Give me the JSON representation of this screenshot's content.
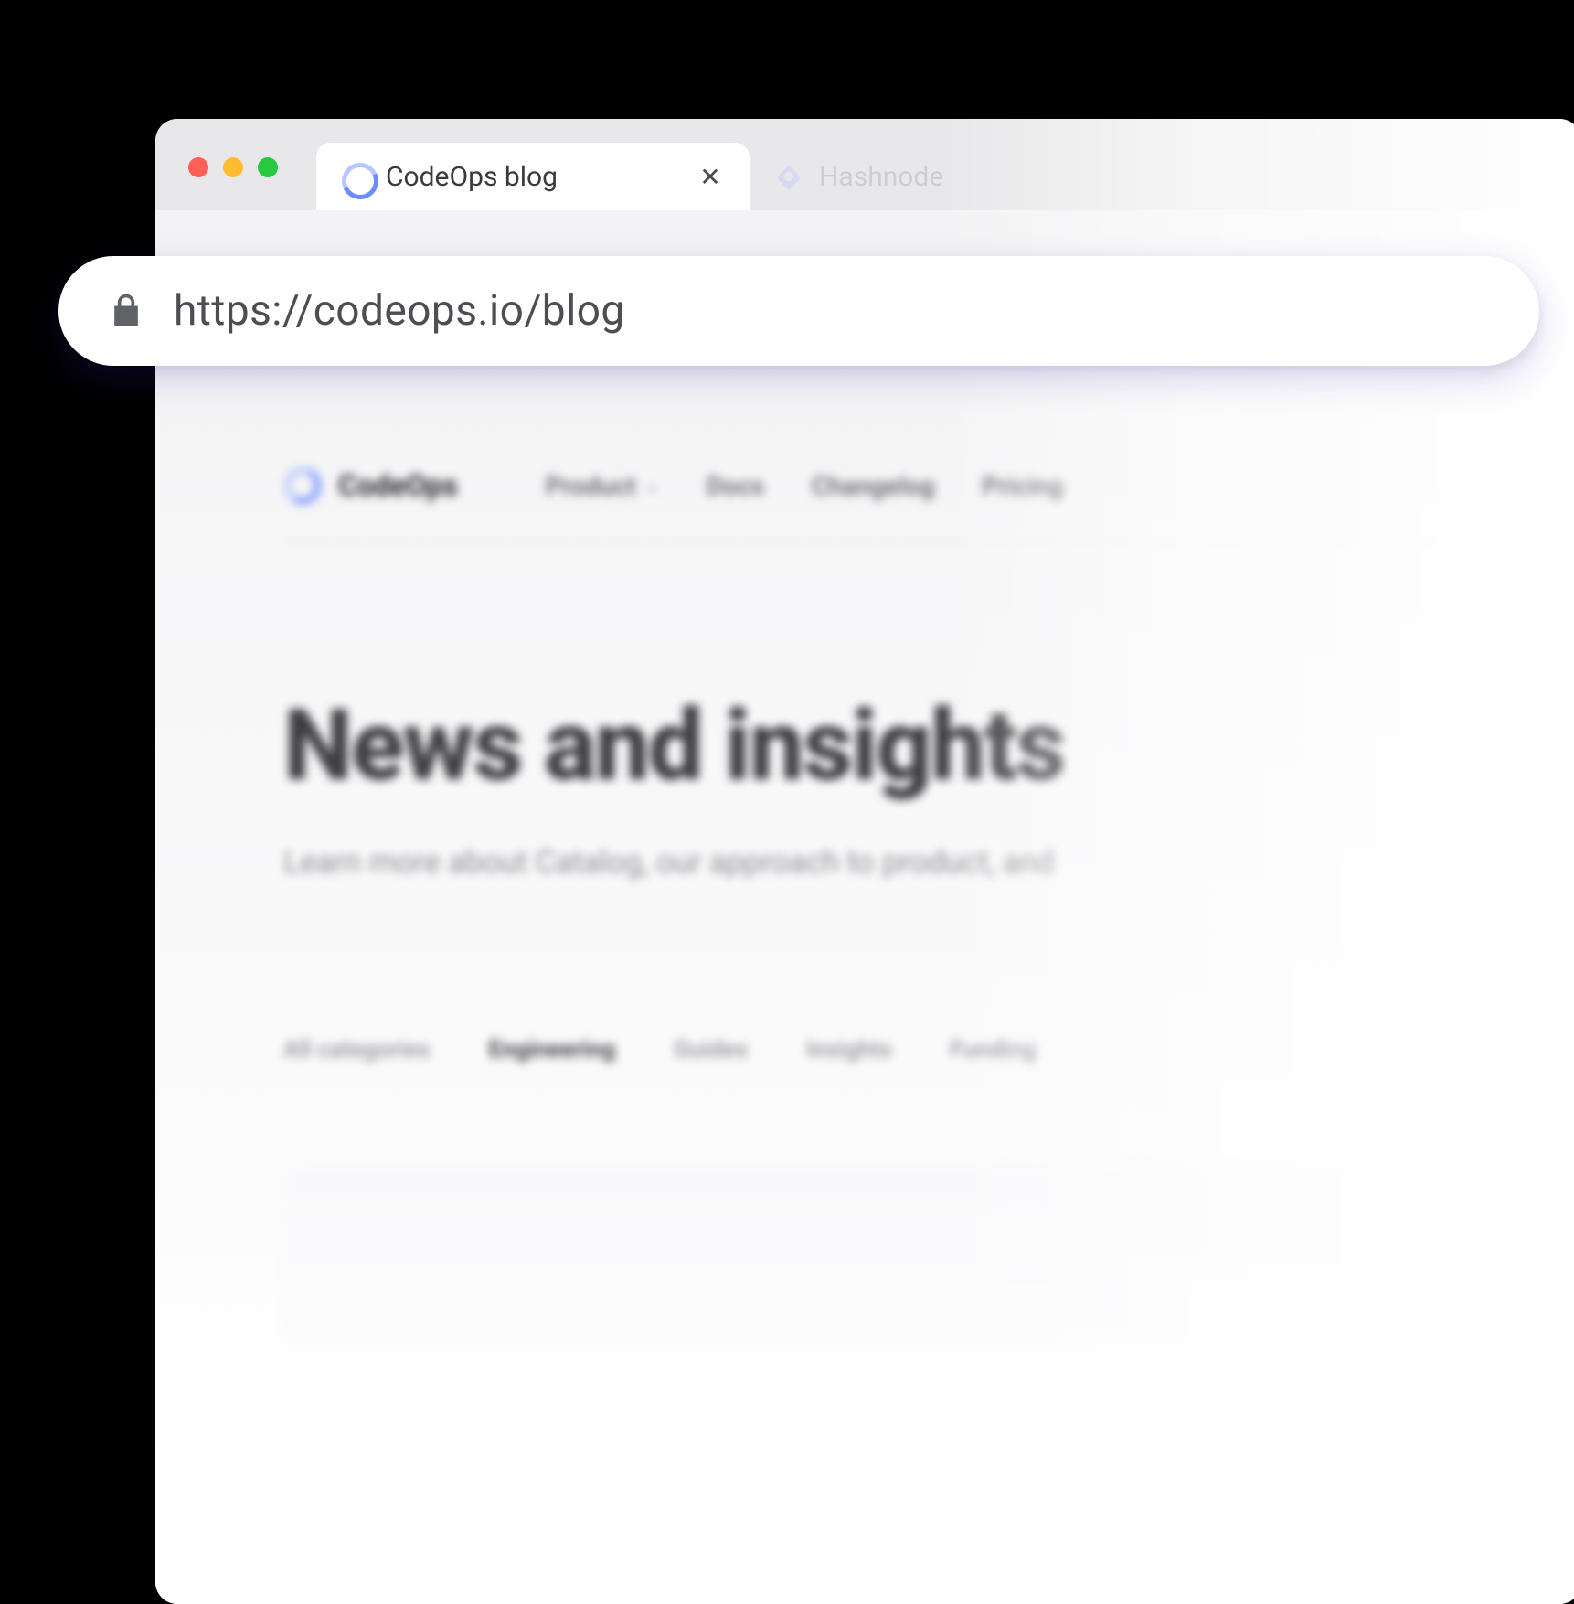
{
  "browser": {
    "tabs": [
      {
        "title": "CodeOps blog",
        "active": true
      },
      {
        "title": "Hashnode",
        "active": false
      }
    ],
    "url": "https://codeops.io/blog"
  },
  "site": {
    "brand": "CodeOps",
    "nav": [
      {
        "label": "Product",
        "hasDropdown": true
      },
      {
        "label": "Docs",
        "hasDropdown": false
      },
      {
        "label": "Changelog",
        "hasDropdown": false
      },
      {
        "label": "Pricing",
        "hasDropdown": false
      }
    ],
    "hero": {
      "title": "News and insights",
      "subtitle": "Learn more about Catalog, our approach to product, and"
    },
    "filters": [
      {
        "label": "All categories",
        "active": false
      },
      {
        "label": "Engineering",
        "active": true
      },
      {
        "label": "Guides",
        "active": false
      },
      {
        "label": "Insights",
        "active": false
      },
      {
        "label": "Funding",
        "active": false
      }
    ]
  }
}
